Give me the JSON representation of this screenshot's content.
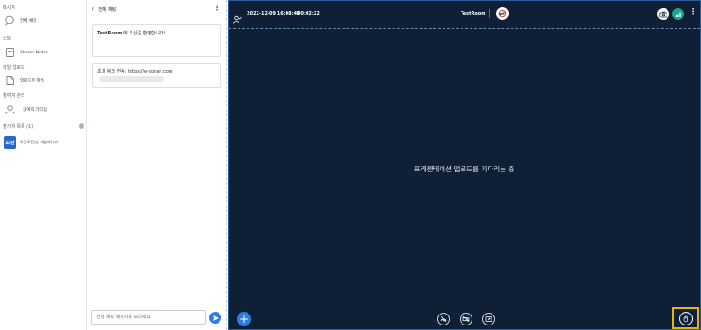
{
  "sidebar": {
    "sections": {
      "message": "메시지",
      "notes": "노트",
      "file_upload": "파일 업로드",
      "participant_manage": "참여자 관리",
      "participant_list": "참가자 목록 (1)"
    },
    "items": {
      "all_chat": "전체 채팅",
      "shared_notes": "Shared Notes",
      "upload_file": "업로드된 파일",
      "waiting_participants": "참여자 기다림"
    },
    "participant": {
      "avatar_initials": "도란",
      "name": "도란도란(방 개설자)(나)"
    }
  },
  "chat": {
    "title": "전체 채팅",
    "messages": [
      {
        "bold": "TestRoom",
        "text": " 에 오신걸 환영합니다!"
      },
      {
        "bold": "",
        "text": "초대 링크 전송: https://e-doran.com"
      }
    ],
    "input_placeholder": "전체 채팅 메시지를 보내세요"
  },
  "stage": {
    "datetime": "2022-12-09 16:08:43",
    "timer": "00:02:22",
    "room_name": "TestRoom",
    "waiting_text": "프레젠테이션 업로드를 기다리는 중"
  },
  "colors": {
    "stage_bg": "#0f2036",
    "accent": "#2f7de1",
    "hand_highlight": "#e8b10f",
    "signal_green": "#1aa58c"
  },
  "icons": {
    "person_check": "person-check-icon",
    "record_off": "record-off-icon",
    "camera": "camera-icon",
    "signal": "signal-icon",
    "hand": "raise-hand-icon"
  }
}
